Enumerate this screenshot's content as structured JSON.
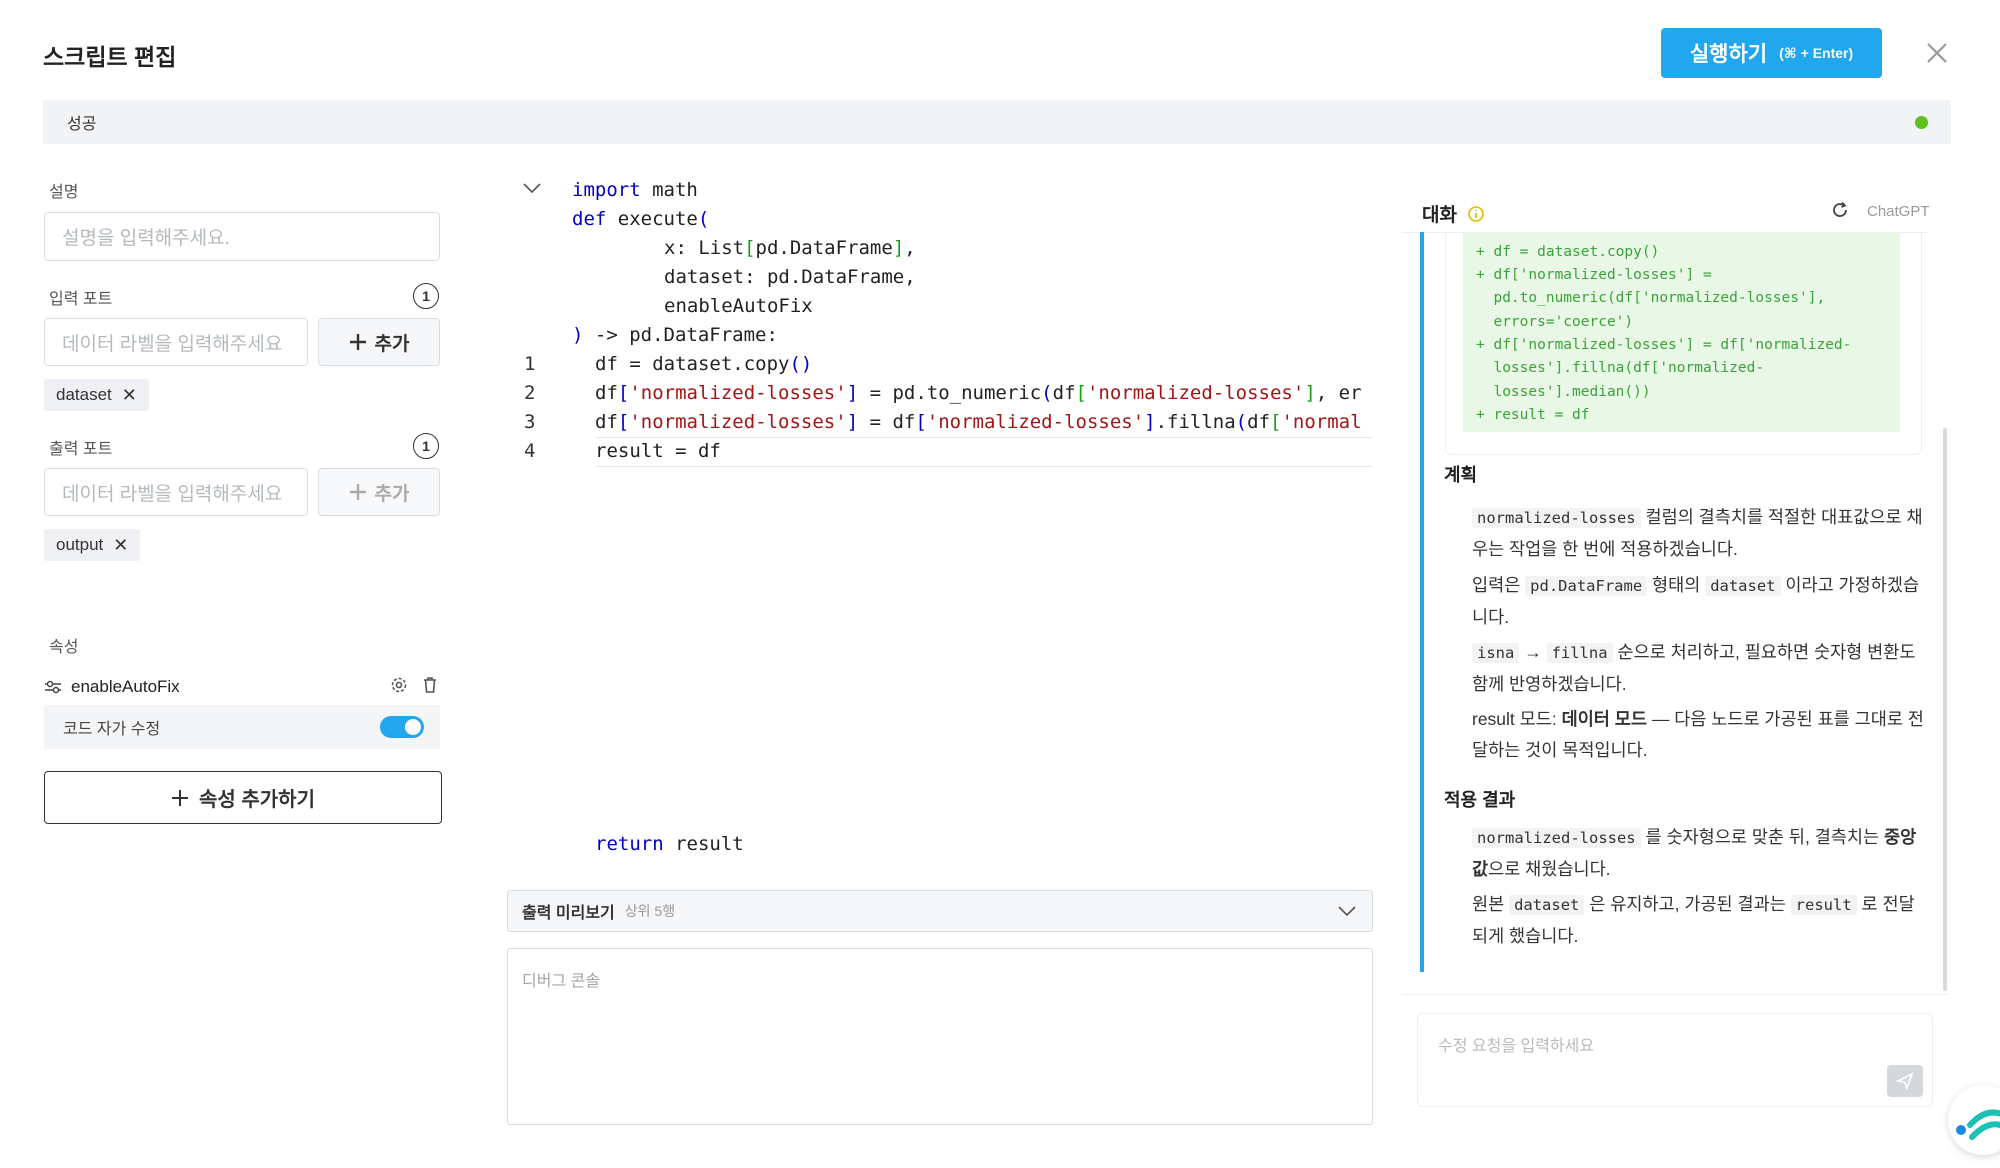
{
  "header": {
    "title": "스크립트 편집",
    "run_label": "실행하기",
    "run_shortcut": "(⌘ + Enter)"
  },
  "status": {
    "text": "성공",
    "color": "#5ec21a"
  },
  "left_panel": {
    "description_label": "설명",
    "description_placeholder": "설명을 입력해주세요.",
    "input_port_label": "입력 포트",
    "input_port_count": "1",
    "input_placeholder": "데이터 라벨을 입력해주세요",
    "input_add_label": "추가",
    "input_chip": "dataset",
    "output_port_label": "출력 포트",
    "output_port_count": "1",
    "output_placeholder": "데이터 라벨을 입력해주세요",
    "output_add_label": "추가",
    "output_chip": "output",
    "attributes_label": "속성",
    "attr_name": "enableAutoFix",
    "attr_toggle_label": "코드 자가 수정",
    "attr_toggle_on": true,
    "add_attr_label": "속성 추가하기"
  },
  "editor": {
    "header_lines": [
      "import math",
      "def execute(",
      "x: List[pd.DataFrame],",
      "dataset: pd.DataFrame,",
      "enableAutoFix",
      ") -> pd.DataFrame:"
    ],
    "line_numbers": [
      "1",
      "2",
      "3",
      "4"
    ],
    "body_lines": [
      "df = dataset.copy()",
      "df['normalized-losses'] = pd.to_numeric(df['normalized-losses'], er",
      "df['normalized-losses'] = df['normalized-losses'].fillna(df['normal",
      "result = df"
    ],
    "return_line": "return result"
  },
  "preview": {
    "title": "출력 미리보기",
    "subtitle": "상위 5행"
  },
  "console": {
    "placeholder": "디버그 콘솔"
  },
  "chat": {
    "title": "대화",
    "model_label": "ChatGPT",
    "diff_lines": [
      "+ df = dataset.copy()",
      "+ df['normalized-losses'] =",
      "  pd.to_numeric(df['normalized-losses'],",
      "  errors='coerce')",
      "+ df['normalized-losses'] = df['normalized-",
      "  losses'].fillna(df['normalized-",
      "  losses'].median())",
      "+ result = df"
    ],
    "plan_heading": "계획",
    "plan_p1_code": "normalized-losses",
    "plan_p1_text": " 컬럼의 결측치를 적절한 대표값으로 채우는 작업을 한 번에 적용하겠습니다.",
    "plan_p2_a": "입력은 ",
    "plan_p2_code1": "pd.DataFrame",
    "plan_p2_b": " 형태의 ",
    "plan_p2_code2": "dataset",
    "plan_p2_c": " 이라고 가정하겠습니다.",
    "plan_p3_code1": "isna",
    "plan_p3_arrow": " → ",
    "plan_p3_code2": "fillna",
    "plan_p3_text": " 순으로 처리하고, 필요하면 숫자형 변환도 함께 반영하겠습니다.",
    "plan_p4_a": "result 모드: ",
    "plan_p4_bold": "데이터 모드",
    "plan_p4_b": " — 다음 노드로 가공된 표를 그대로 전달하는 것이 목적입니다.",
    "result_heading": "적용 결과",
    "res_p1_code": "normalized-losses",
    "res_p1_a": " 를 숫자형으로 맞춘 뒤, 결측치는 ",
    "res_p1_bold": "중앙값",
    "res_p1_b": "으로 채웠습니다.",
    "res_p2_a": "원본 ",
    "res_p2_code1": "dataset",
    "res_p2_b": " 은 유지하고, 가공된 결과는 ",
    "res_p2_code2": "result",
    "res_p2_c": " 로 전달되게 했습니다.",
    "input_placeholder": "수정 요청을 입력하세요"
  },
  "colors": {
    "accent": "#22a7ef",
    "success": "#5ec21a",
    "chat_border": "#22a7ef",
    "diff_green": "#3aa33a"
  }
}
